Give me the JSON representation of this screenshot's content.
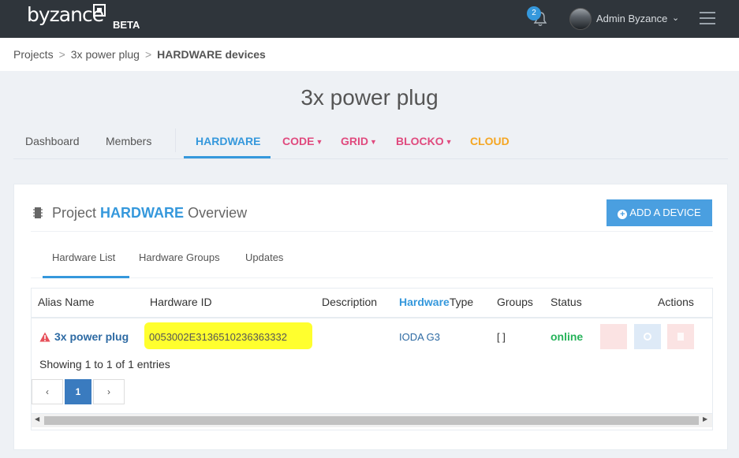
{
  "topbar": {
    "logo_text": "byzance",
    "beta_label": "BETA",
    "notification_count": "2",
    "user_name": "Admin Byzance",
    "caret": "⌄"
  },
  "breadcrumb": {
    "items": [
      "Projects",
      "3x power plug",
      "HARDWARE devices"
    ],
    "separator": ">"
  },
  "page": {
    "title": "3x power plug"
  },
  "main_tabs": [
    {
      "label": "Dashboard",
      "color": "#555555"
    },
    {
      "label": "Members",
      "color": "#555555"
    },
    {
      "label": "HARDWARE",
      "color": "#3598dc",
      "active": true
    },
    {
      "label": "CODE",
      "color": "#e04a7e",
      "dropdown": true
    },
    {
      "label": "GRID",
      "color": "#e04a7e",
      "dropdown": true
    },
    {
      "label": "BLOCKO",
      "color": "#e04a7e",
      "dropdown": true
    },
    {
      "label": "CLOUD",
      "color": "#f5a623"
    }
  ],
  "portlet": {
    "title_prefix": "Project",
    "title_strong": "HARDWARE",
    "title_suffix": "Overview",
    "add_button_label": "ADD A DEVICE",
    "add_button_icon": "+"
  },
  "sub_tabs": [
    {
      "label": "Hardware List",
      "active": true
    },
    {
      "label": "Hardware Groups"
    },
    {
      "label": "Updates"
    }
  ],
  "table": {
    "columns": {
      "alias": "Alias Name",
      "hardware_id": "Hardware ID",
      "description": "Description",
      "type_highlight": "Hardware",
      "type_rest": "Type",
      "groups": "Groups",
      "status": "Status",
      "actions": "Actions"
    },
    "rows": [
      {
        "alias": "3x power plug",
        "hardware_id": "0053002E3136510236363332",
        "description": "",
        "type": "IODA G3",
        "groups": "[ ]",
        "status": "online"
      }
    ],
    "action_colors": [
      "#f8d0d0",
      "#d3e6f7",
      "#f8d0d0"
    ],
    "showing_text": "Showing 1 to 1 of 1 entries",
    "pager": {
      "prev": "‹",
      "page": "1",
      "next": "›"
    },
    "scroll_left": "◀",
    "scroll_right": "▶"
  },
  "colors": {
    "topbar": "#2f353b",
    "accent": "#3598dc",
    "online": "#26b35a",
    "highlight": "#ffff2e"
  }
}
